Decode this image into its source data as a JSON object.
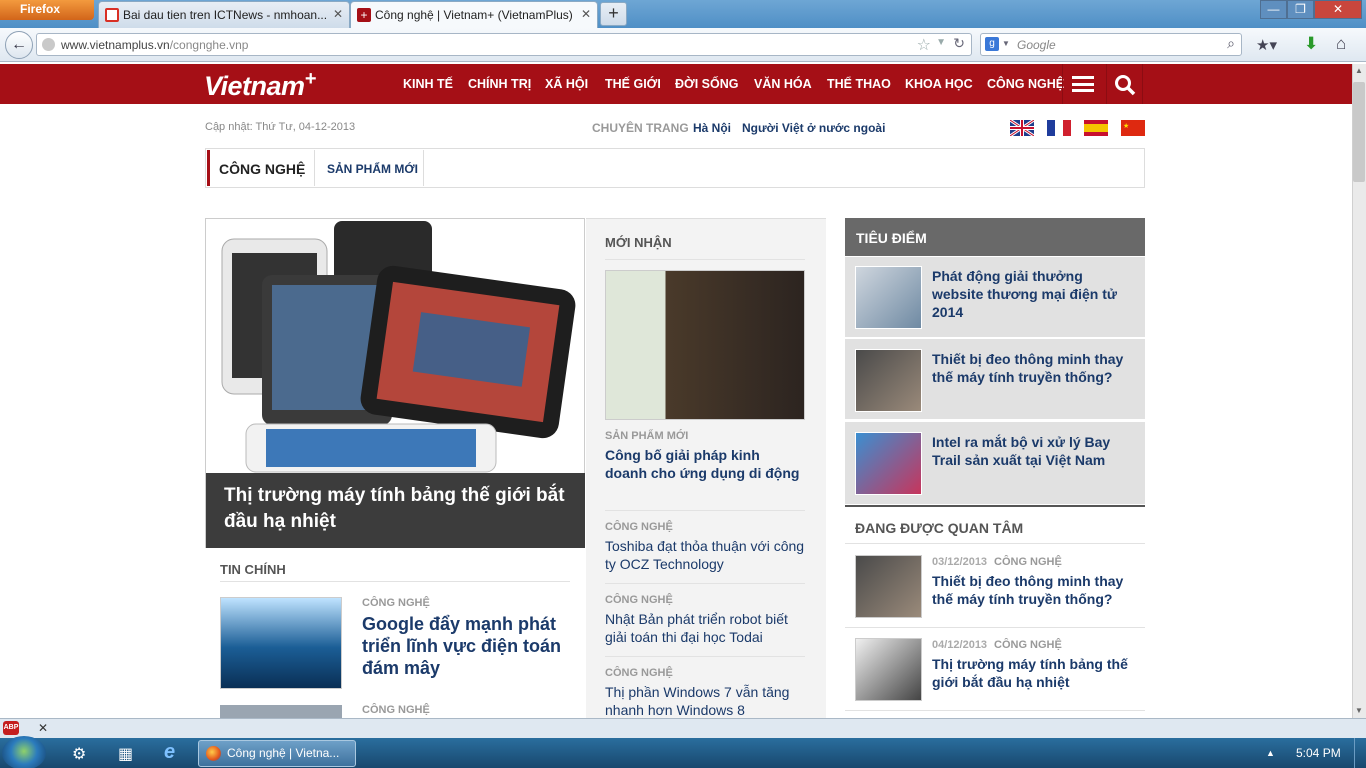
{
  "browser": {
    "menu_label": "Firefox",
    "tabs": [
      {
        "title": "Bai dau tien tren ICTNews - nmhoan..."
      },
      {
        "title": "Công nghệ | Vietnam+ (VietnamPlus)"
      }
    ],
    "new_tab": "+",
    "url_host": "www.vietnamplus.vn",
    "url_path": "/congnghe.vnp",
    "search_placeholder": "Google",
    "window_buttons": [
      "—",
      "❐",
      "✕"
    ]
  },
  "site": {
    "logo": "Vietnam",
    "logo_plus": "+",
    "nav": [
      "KINH TẾ",
      "CHÍNH TRỊ",
      "XÃ HỘI",
      "THẾ GIỚI",
      "ĐỜI SỐNG",
      "VĂN HÓA",
      "THỂ THAO",
      "KHOA HỌC",
      "CÔNG NGHỆ"
    ],
    "updated": "Cập nhật: Thứ Tư, 04-12-2013",
    "chuyen_trang": "CHUYÊN TRANG",
    "special_links": [
      "Hà Nội",
      "Người Việt ở nước ngoài"
    ],
    "section_tabs": [
      "CÔNG NGHỆ",
      "SẢN PHẨM MỚI"
    ]
  },
  "feature": {
    "headline": "Thị trường máy tính bảng thế giới bắt đầu hạ nhiệt"
  },
  "tin_chinh": {
    "heading": "TIN CHÍNH",
    "items": [
      {
        "category": "CÔNG NGHỆ",
        "headline": "Google đẩy mạnh phát triển lĩnh vực điện toán đám mây"
      },
      {
        "category": "CÔNG NGHỆ",
        "headline": ""
      }
    ]
  },
  "moi_nhan": {
    "heading": "MỚI NHẬN",
    "items": [
      {
        "category": "SẢN PHẨM MỚI",
        "headline": "Công bố giải pháp kinh doanh cho ứng dụng di động"
      },
      {
        "category": "CÔNG NGHỆ",
        "headline": "Toshiba đạt thỏa thuận với công ty OCZ Technology"
      },
      {
        "category": "CÔNG NGHỆ",
        "headline": "Nhật Bản phát triển robot biết giải toán thi đại học Todai"
      },
      {
        "category": "CÔNG NGHỆ",
        "headline": "Thị phần Windows 7 vẫn tăng nhanh hơn Windows 8"
      }
    ]
  },
  "tieu_diem": {
    "heading": "TIÊU ĐIỂM",
    "items": [
      {
        "headline": "Phát động giải thưởng website thương mại điện tử 2014"
      },
      {
        "headline": "Thiết bị đeo thông minh thay thế máy tính truyền thống?"
      },
      {
        "headline": "Intel ra mắt bộ vi xử lý Bay Trail sản xuất tại Việt Nam"
      }
    ]
  },
  "dang_quan_tam": {
    "heading": "ĐANG ĐƯỢC QUAN TÂM",
    "items": [
      {
        "date": "03/12/2013",
        "category": "CÔNG NGHỆ",
        "headline": "Thiết bị đeo thông minh thay thế máy tính truyền thống?"
      },
      {
        "date": "04/12/2013",
        "category": "CÔNG NGHỆ",
        "headline": "Thị trường máy tính bảng thế giới bắt đầu hạ nhiệt"
      }
    ]
  },
  "taskbar": {
    "task_label": "Công nghệ | Vietna...",
    "clock": "5:04 PM"
  },
  "colors": {
    "brand_red": "#a50f16",
    "link_blue": "#1b3a6a",
    "taskbar": "#1f5a86"
  }
}
